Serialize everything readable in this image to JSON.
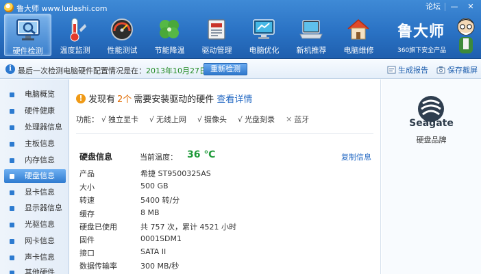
{
  "app": {
    "title": "鲁大师 www.ludashi.com"
  },
  "window": {
    "forum": "论坛",
    "minimize": "—",
    "close": "✕"
  },
  "toolbar": [
    {
      "label": "硬件检测",
      "icon": "monitor-magnifier-icon",
      "active": true
    },
    {
      "label": "温度监测",
      "icon": "thermometer-icon",
      "active": false
    },
    {
      "label": "性能测试",
      "icon": "speedometer-icon",
      "active": false
    },
    {
      "label": "节能降温",
      "icon": "clover-leaf-icon",
      "active": false
    },
    {
      "label": "驱动管理",
      "icon": "driver-chip-icon",
      "active": false
    },
    {
      "label": "电脑优化",
      "icon": "monitor-sparkle-icon",
      "active": false
    },
    {
      "label": "新机推荐",
      "icon": "laptop-icon",
      "active": false
    },
    {
      "label": "电脑维修",
      "icon": "house-wrench-icon",
      "active": false
    }
  ],
  "brand": {
    "name": "鲁大师",
    "tagline": "360旗下安全产品"
  },
  "status": {
    "message_prefix": "最后一次检测电脑硬件配置情况是在：",
    "date": "2013年10月27日",
    "rescan": "重新检测",
    "report": "生成报告",
    "screenshot": "保存截屏"
  },
  "sidebar": {
    "items": [
      {
        "label": "电脑概览"
      },
      {
        "label": "硬件健康"
      },
      {
        "label": "处理器信息"
      },
      {
        "label": "主板信息"
      },
      {
        "label": "内存信息"
      },
      {
        "label": "硬盘信息",
        "active": true
      },
      {
        "label": "显卡信息"
      },
      {
        "label": "显示器信息"
      },
      {
        "label": "光驱信息"
      },
      {
        "label": "网卡信息"
      },
      {
        "label": "声卡信息"
      },
      {
        "label": "其他硬件"
      }
    ]
  },
  "main": {
    "alert": {
      "prefix": "发现有",
      "count": "2个",
      "suffix": "需要安装驱动的硬件",
      "link": "查看详情"
    },
    "features_label": "功能：",
    "features": [
      {
        "mark": "√",
        "name": "独立显卡"
      },
      {
        "mark": "√",
        "name": "无线上网"
      },
      {
        "mark": "√",
        "name": "摄像头"
      },
      {
        "mark": "√",
        "name": "光盘刻录"
      },
      {
        "mark": "✕",
        "name": "蓝牙"
      }
    ],
    "disk": {
      "title": "硬盘信息",
      "temp_label": "当前温度：",
      "temp_value": "36 ℃",
      "copy": "复制信息",
      "specs": [
        {
          "k": "产品",
          "v": "希捷 ST9500325AS"
        },
        {
          "k": "大小",
          "v": "500 GB"
        },
        {
          "k": "转速",
          "v": "5400 转/分"
        },
        {
          "k": "缓存",
          "v": "8 MB"
        },
        {
          "k": "硬盘已使用",
          "v": "共 757 次，累计 4521 小时"
        },
        {
          "k": "固件",
          "v": "0001SDM1"
        },
        {
          "k": "接口",
          "v": "SATA II"
        },
        {
          "k": "数据传输率",
          "v": "300 MB/秒"
        }
      ]
    }
  },
  "vendor": {
    "name": "Seagate",
    "caption": "硬盘品牌"
  },
  "colors": {
    "accent": "#2a72c4",
    "temp_ok": "#1f9a3a",
    "warn": "#f09a16",
    "link": "#1f66c2"
  }
}
